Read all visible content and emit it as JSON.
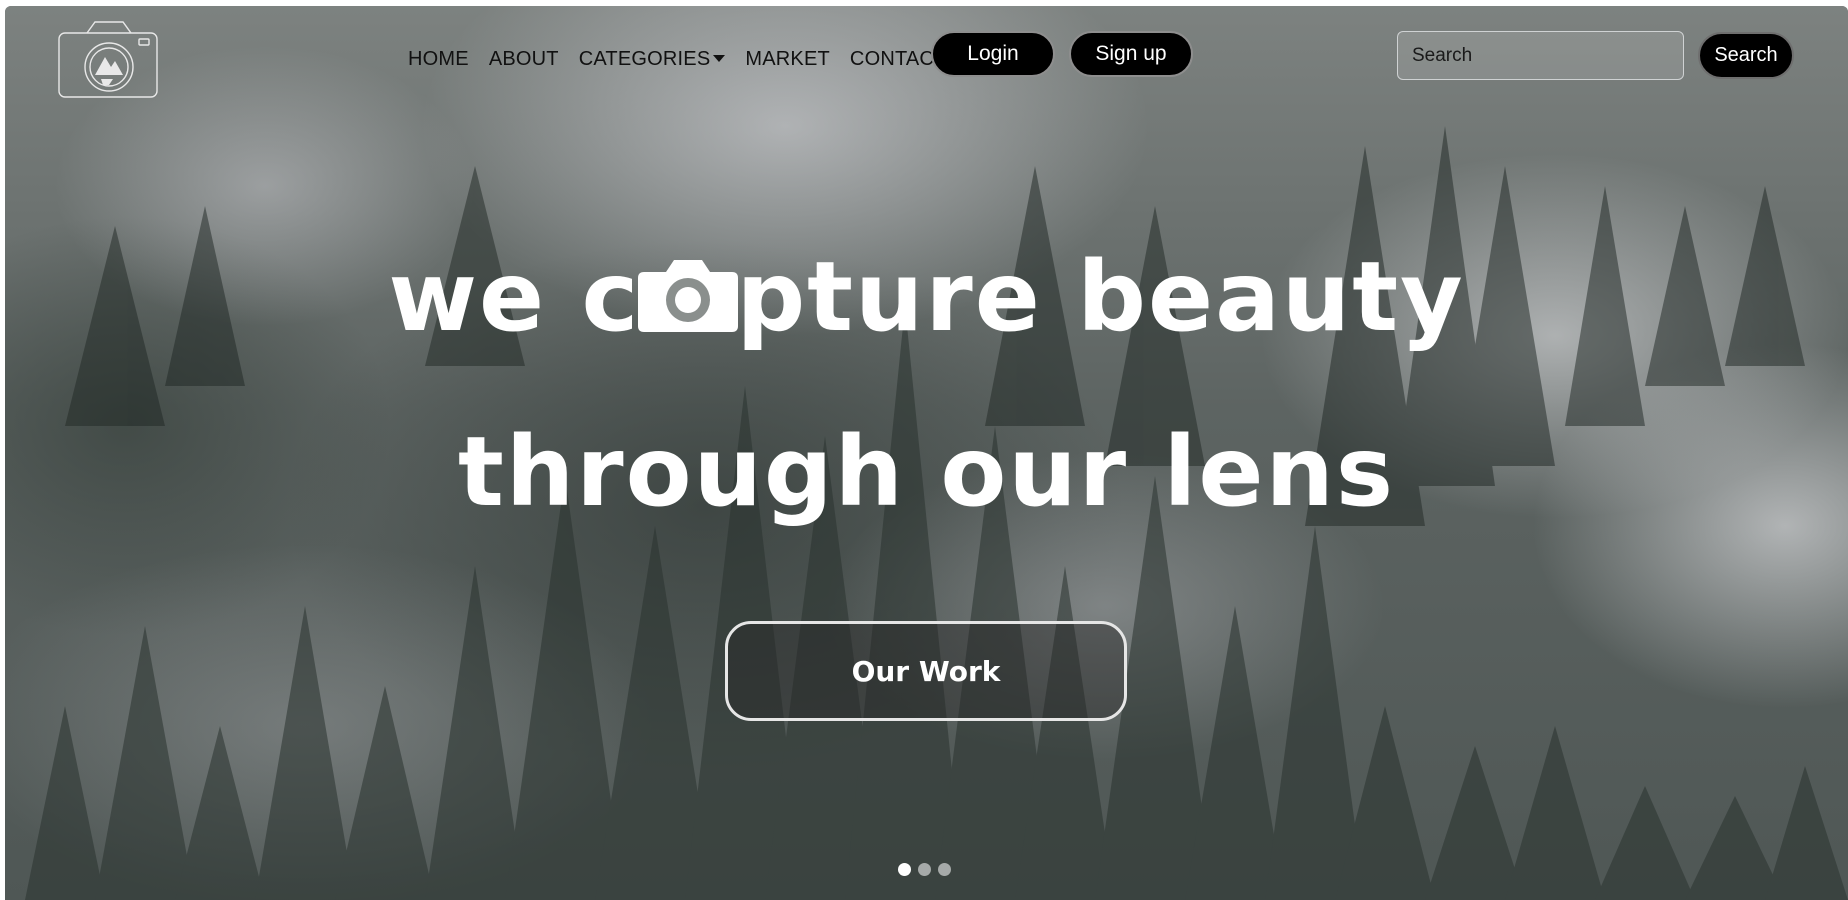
{
  "nav": {
    "logo_name": "camera-logo-icon",
    "links": [
      {
        "label": "HOME"
      },
      {
        "label": "ABOUT"
      },
      {
        "label": "CATEGORIES"
      },
      {
        "label": "MARKET"
      },
      {
        "label": "CONTACT"
      }
    ],
    "login_label": "Login",
    "signup_label": "Sign up",
    "search_placeholder": "Search",
    "search_value": "",
    "search_button_label": "Search"
  },
  "hero": {
    "line1_part1": "we c",
    "line1_icon": "camera-icon",
    "line1_part2": "pture beauty",
    "line2": "through our lens",
    "cta_label": "Our Work"
  },
  "carousel": {
    "slide_count": 3,
    "active_index": 0
  },
  "colors": {
    "button_bg": "#000000",
    "text_on_hero": "#ffffff",
    "nav_text": "#111111"
  }
}
